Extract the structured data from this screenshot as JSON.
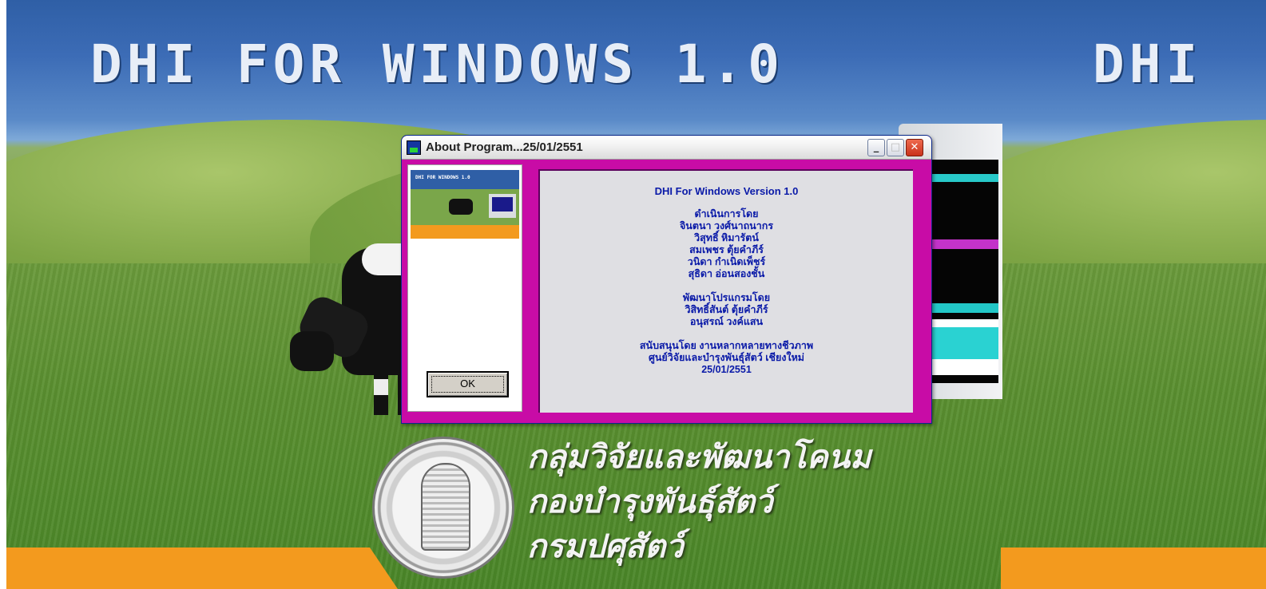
{
  "wallpaper": {
    "title": "DHI FOR WINDOWS 1.0",
    "title_partial": "DHI",
    "slogan": [
      "กลุ่มวิจัยและพัฒนาโคนม",
      "กองบำรุงพันธุ์สัตว์",
      "กรมปศุสัตว์"
    ]
  },
  "dialog": {
    "title": "About Program...25/01/2551",
    "buttons": {
      "minimize": "_",
      "maximize": "□",
      "close": "✕"
    },
    "thumbnail_title": "DHI FOR WINDOWS 1.0",
    "ok_label": "OK",
    "content": {
      "heading": "DHI For Windows Version 1.0",
      "operated_by_label": "ดำเนินการโดย",
      "operated_by": [
        "จินตนา  วงศ์นาถนากร",
        "วิสุทธิ์  หิมารัตน์",
        "สมเพชร  ตุ้ยคำภีร์",
        "วนิดา  กำเนิดเพ็ชร์",
        "สุธิดา  อ่อนสองชั้น"
      ],
      "developed_by_label": "พัฒนาโปรแกรมโดย",
      "developed_by": [
        "วิสิทธิ์สันต์  ตุ้ยคำภีร์",
        "อนุสรณ์ วงค์แสน"
      ],
      "supported_by": "สนับสนุนโดย งานหลากหลายทางชีวภาพ",
      "center": "ศูนย์วิจัยและบำรุงพันธุ์สัตว์ เชียงใหม่",
      "date": "25/01/2551"
    }
  },
  "colors": {
    "dialog_frame": "#c80ca6",
    "content_text": "#0a1aa8",
    "content_bg": "#dfdfe3",
    "orange_bar": "#f39a1e",
    "sky": "#2f5fa6"
  }
}
